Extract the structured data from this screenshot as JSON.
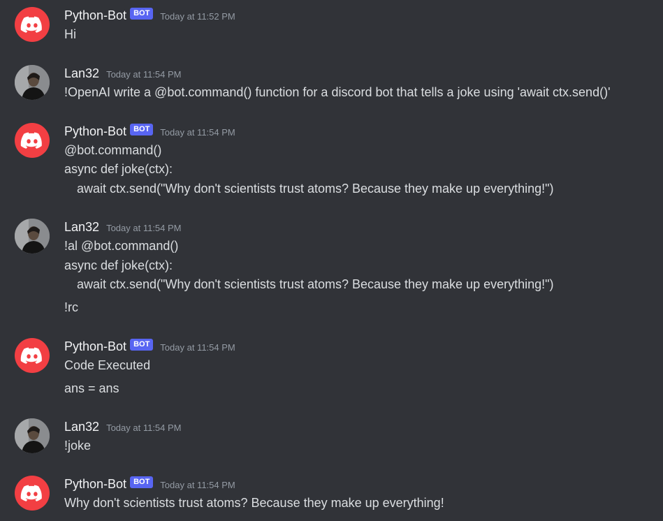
{
  "colors": {
    "background": "#313338",
    "text": "#dbdee1",
    "username": "#f2f3f5",
    "timestamp": "#949ba4",
    "bot_tag": "#5865f2",
    "bot_avatar": "#f23f43"
  },
  "messages": [
    {
      "author": "Python-Bot",
      "bot_tag": "BOT",
      "timestamp": "Today at 11:52 PM",
      "avatar_icon": "discord-logo-icon",
      "lines": [
        "Hi"
      ]
    },
    {
      "author": "Lan32",
      "timestamp": "Today at 11:54 PM",
      "avatar_icon": "user-photo-avatar",
      "lines": [
        "!OpenAI write a @bot.command() function for a discord bot that tells a joke using 'await ctx.send()'"
      ]
    },
    {
      "author": "Python-Bot",
      "bot_tag": "BOT",
      "timestamp": "Today at 11:54 PM",
      "avatar_icon": "discord-logo-icon",
      "lines": [
        "@bot.command()",
        "async def joke(ctx):",
        "await ctx.send(\"Why don't scientists trust atoms? Because they make up everything!\")"
      ]
    },
    {
      "author": "Lan32",
      "timestamp": "Today at 11:54 PM",
      "avatar_icon": "user-photo-avatar",
      "lines": [
        "!al @bot.command()",
        "async def joke(ctx):",
        "await ctx.send(\"Why don't scientists trust atoms? Because they make up everything!\")",
        "!rc"
      ]
    },
    {
      "author": "Python-Bot",
      "bot_tag": "BOT",
      "timestamp": "Today at 11:54 PM",
      "avatar_icon": "discord-logo-icon",
      "lines": [
        "Code Executed",
        "ans = ans"
      ]
    },
    {
      "author": "Lan32",
      "timestamp": "Today at 11:54 PM",
      "avatar_icon": "user-photo-avatar",
      "lines": [
        "!joke"
      ]
    },
    {
      "author": "Python-Bot",
      "bot_tag": "BOT",
      "timestamp": "Today at 11:54 PM",
      "avatar_icon": "discord-logo-icon",
      "lines": [
        "Why don't scientists trust atoms? Because they make up everything!"
      ]
    }
  ]
}
